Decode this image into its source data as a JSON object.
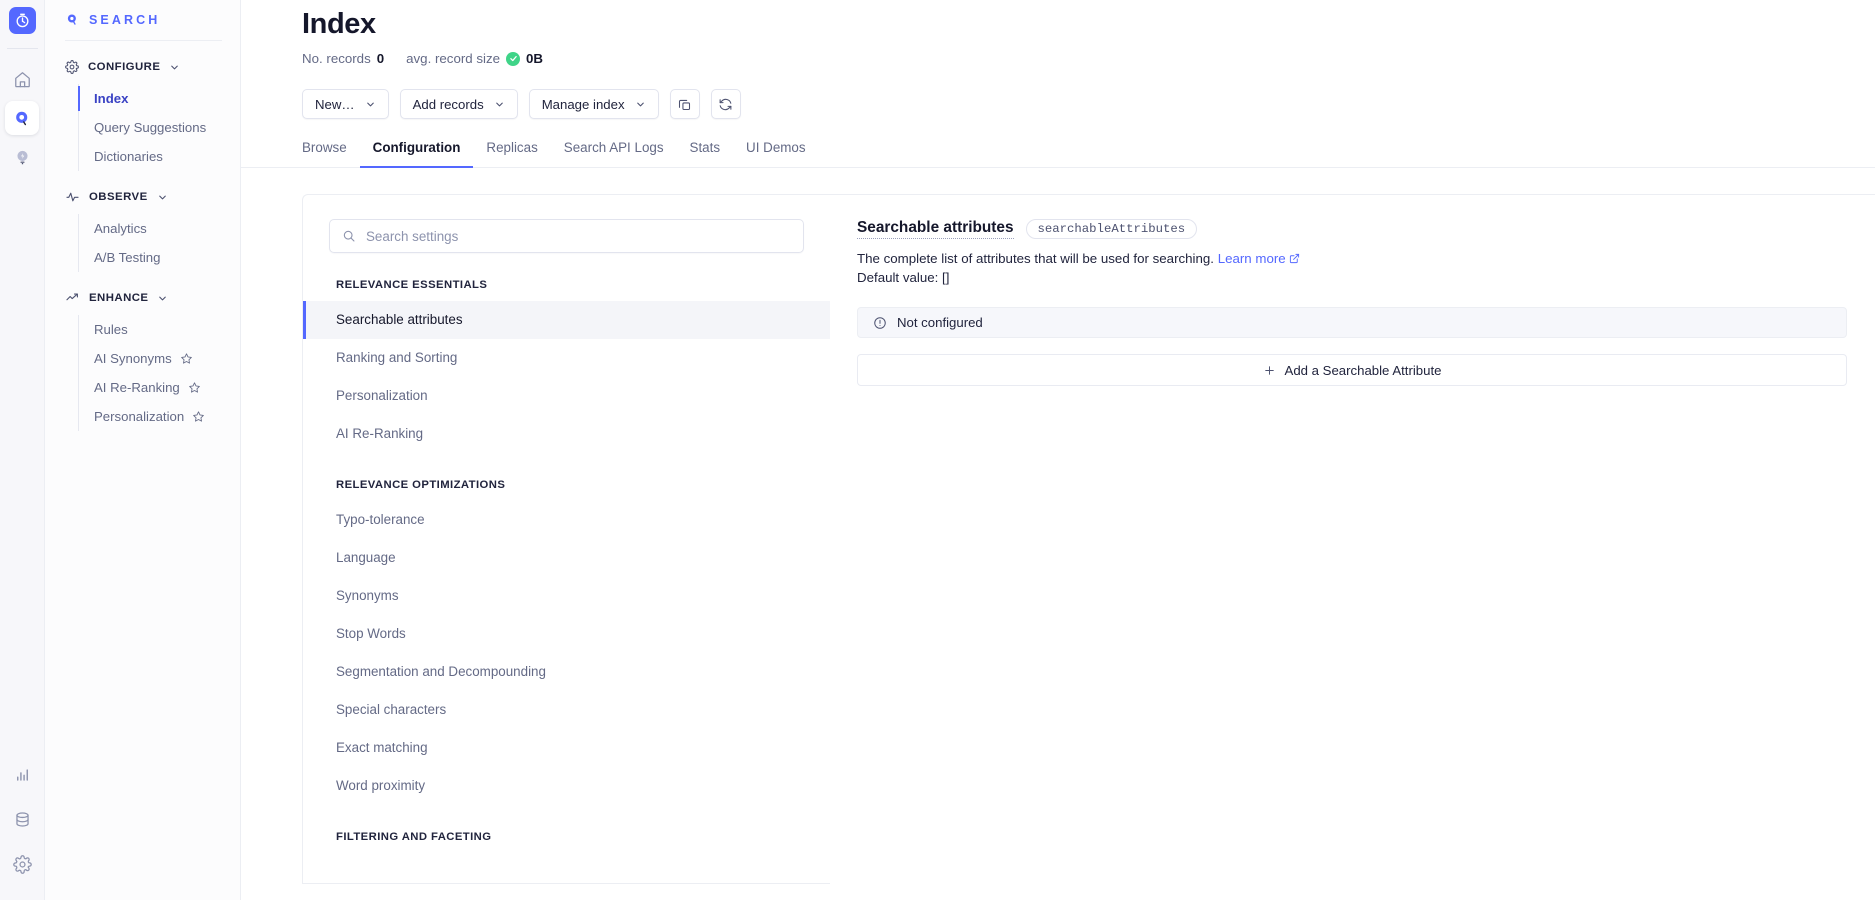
{
  "rail": {
    "logo_icon": "algolia-logo-icon",
    "items": [
      {
        "name": "home-icon",
        "label": "Home",
        "active": false
      },
      {
        "name": "search-icon",
        "label": "Search",
        "active": true
      },
      {
        "name": "lightbulb-icon",
        "label": "Recommend",
        "active": false
      }
    ],
    "bottom_items": [
      {
        "name": "bar-chart-icon",
        "label": "Analytics"
      },
      {
        "name": "database-icon",
        "label": "Data sources"
      },
      {
        "name": "gear-icon",
        "label": "Settings"
      }
    ]
  },
  "sidebar": {
    "brand": "SEARCH",
    "brand_icon": "algolia-mark-icon",
    "groups": [
      {
        "title": "CONFIGURE",
        "icon": "gear-icon",
        "chevron": "chevron-down-icon",
        "items": [
          {
            "label": "Index",
            "current": true,
            "star": false
          },
          {
            "label": "Query Suggestions",
            "current": false,
            "star": false
          },
          {
            "label": "Dictionaries",
            "current": false,
            "star": false
          }
        ]
      },
      {
        "title": "OBSERVE",
        "icon": "pulse-icon",
        "chevron": "chevron-down-icon",
        "items": [
          {
            "label": "Analytics",
            "current": false,
            "star": false
          },
          {
            "label": "A/B Testing",
            "current": false,
            "star": false
          }
        ]
      },
      {
        "title": "ENHANCE",
        "icon": "trend-up-icon",
        "chevron": "chevron-down-icon",
        "items": [
          {
            "label": "Rules",
            "current": false,
            "star": false
          },
          {
            "label": "AI Synonyms",
            "current": false,
            "star": true
          },
          {
            "label": "AI Re-Ranking",
            "current": false,
            "star": true
          },
          {
            "label": "Personalization",
            "current": false,
            "star": true
          }
        ]
      }
    ]
  },
  "header": {
    "title": "Index",
    "stats": {
      "records_label": "No. records",
      "records_value": "0",
      "size_label": "avg. record size",
      "size_value": "0B",
      "size_status_icon": "check-circle-icon",
      "size_status_color": "#3fd488"
    }
  },
  "toolbar": {
    "buttons": [
      {
        "label": "New…",
        "icon": "chevron-down-icon"
      },
      {
        "label": "Add records",
        "icon": "chevron-down-icon"
      },
      {
        "label": "Manage index",
        "icon": "chevron-down-icon"
      }
    ],
    "icon_buttons": [
      {
        "name": "copy-icon",
        "label": "Copy"
      },
      {
        "name": "refresh-icon",
        "label": "Refresh"
      }
    ]
  },
  "tabs": [
    {
      "label": "Browse",
      "active": false
    },
    {
      "label": "Configuration",
      "active": true
    },
    {
      "label": "Replicas",
      "active": false
    },
    {
      "label": "Search API Logs",
      "active": false
    },
    {
      "label": "Stats",
      "active": false
    },
    {
      "label": "UI Demos",
      "active": false
    }
  ],
  "settings": {
    "search": {
      "placeholder": "Search settings",
      "value": "",
      "icon": "search-icon"
    },
    "sections": [
      {
        "title": "RELEVANCE ESSENTIALS",
        "items": [
          {
            "label": "Searchable attributes",
            "selected": true
          },
          {
            "label": "Ranking and Sorting",
            "selected": false
          },
          {
            "label": "Personalization",
            "selected": false
          },
          {
            "label": "AI Re-Ranking",
            "selected": false
          }
        ]
      },
      {
        "title": "RELEVANCE OPTIMIZATIONS",
        "items": [
          {
            "label": "Typo-tolerance",
            "selected": false
          },
          {
            "label": "Language",
            "selected": false
          },
          {
            "label": "Synonyms",
            "selected": false
          },
          {
            "label": "Stop Words",
            "selected": false
          },
          {
            "label": "Segmentation and Decompounding",
            "selected": false
          },
          {
            "label": "Special characters",
            "selected": false
          },
          {
            "label": "Exact matching",
            "selected": false
          },
          {
            "label": "Word proximity",
            "selected": false
          }
        ]
      },
      {
        "title": "FILTERING AND FACETING",
        "items": []
      }
    ]
  },
  "detail": {
    "title": "Searchable attributes",
    "code": "searchableAttributes",
    "description": "The complete list of attributes that will be used for searching.",
    "learn_more": "Learn more",
    "learn_more_icon": "external-link-icon",
    "default_value": "Default value: []",
    "status": {
      "icon": "info-circle-icon",
      "text": "Not configured"
    },
    "add_button": {
      "icon": "plus-icon",
      "label": "Add a Searchable Attribute"
    }
  },
  "colors": {
    "accent": "#5468ff",
    "text": "#21243d",
    "muted": "#646a86",
    "success": "#3fd488",
    "panel_bg": "#f4f5f9"
  }
}
